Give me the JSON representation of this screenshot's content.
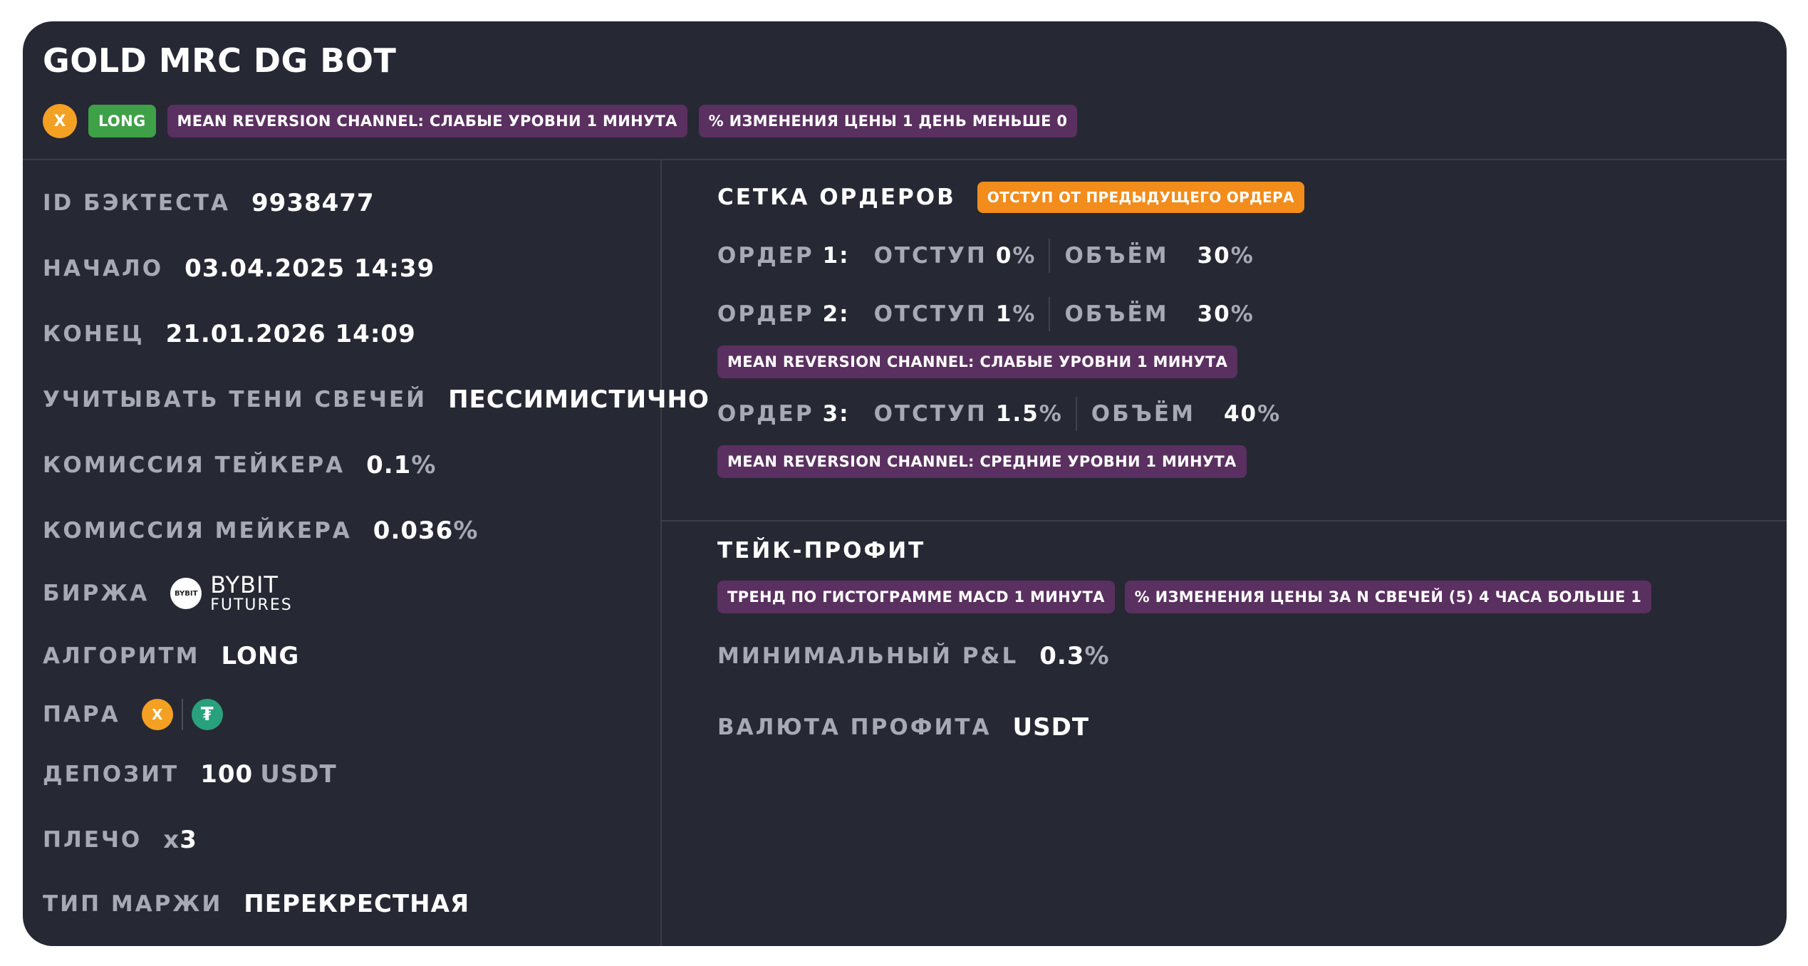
{
  "header": {
    "title": "GOLD MRC DG BOT",
    "coin_symbol": "X",
    "tags": {
      "direction": "LONG",
      "condition1": "MEAN REVERSION CHANNEL: СЛАБЫЕ УРОВНИ 1 МИНУТА",
      "condition2": "% ИЗМЕНЕНИЯ ЦЕНЫ 1 ДЕНЬ МЕНЬШЕ 0"
    }
  },
  "details": {
    "backtest_id": {
      "label": "ID БЭКТЕСТА",
      "value": "9938477"
    },
    "start": {
      "label": "НАЧАЛО",
      "value": "03.04.2025 14:39"
    },
    "end": {
      "label": "КОНЕЦ",
      "value": "21.01.2026 14:09"
    },
    "shadows": {
      "label": "УЧИТЫВАТЬ ТЕНИ СВЕЧЕЙ",
      "value": "ПЕССИМИСТИЧНО"
    },
    "taker_fee": {
      "label": "КОМИССИЯ ТЕЙКЕРА",
      "value": "0.1",
      "unit": "%"
    },
    "maker_fee": {
      "label": "КОМИССИЯ МЕЙКЕРА",
      "value": "0.036",
      "unit": "%"
    },
    "exchange": {
      "label": "БИРЖА",
      "logo_text": "BYBIT",
      "name": "BYBIT",
      "sub": "FUTURES"
    },
    "algorithm": {
      "label": "АЛГОРИТМ",
      "value": "LONG"
    },
    "pair": {
      "label": "ПАРА",
      "base_symbol": "X",
      "quote_symbol": "₮"
    },
    "deposit": {
      "label": "ДЕПОЗИТ",
      "value": "100",
      "unit": "USDT"
    },
    "leverage": {
      "label": "ПЛЕЧО",
      "prefix": "x",
      "value": "3"
    },
    "margin": {
      "label": "ТИП МАРЖИ",
      "value": "ПЕРЕКРЕСТНАЯ"
    }
  },
  "orders": {
    "title": "СЕТКА ОРДЕРОВ",
    "mode_badge": "ОТСТУП ОТ ПРЕДЫДУЩЕГО ОРДЕРА",
    "offset_label": "ОТСТУП",
    "volume_label": "ОБЪЁМ",
    "percent": "%",
    "items": [
      {
        "label": "ОРДЕР",
        "num": "1:",
        "offset": "0",
        "volume": "30"
      },
      {
        "label": "ОРДЕР",
        "num": "2:",
        "offset": "1",
        "volume": "30",
        "condition": "MEAN REVERSION CHANNEL: СЛАБЫЕ УРОВНИ 1 МИНУТА"
      },
      {
        "label": "ОРДЕР",
        "num": "3:",
        "offset": "1.5",
        "volume": "40",
        "condition": "MEAN REVERSION CHANNEL: СРЕДНИЕ УРОВНИ 1 МИНУТА"
      }
    ]
  },
  "take_profit": {
    "title": "ТЕЙК-ПРОФИТ",
    "conditions": [
      "ТРЕНД ПО ГИСТОГРАММЕ MACD 1 МИНУТА",
      "% ИЗМЕНЕНИЯ ЦЕНЫ ЗА N СВЕЧЕЙ (5) 4 ЧАСА БОЛЬШЕ 1"
    ],
    "min_pnl": {
      "label": "МИНИМАЛЬНЫЙ P&L",
      "value": "0.3",
      "unit": "%"
    },
    "currency": {
      "label": "ВАЛЮТА ПРОФИТА",
      "value": "USDT"
    }
  },
  "colors": {
    "card_bg": "#262834",
    "label": "#a7a9b4",
    "long_tag": "#3fa147",
    "condition_tag": "#5a3060",
    "mode_badge": "#f28c1b",
    "coin": "#f3a023",
    "tether": "#28a17c"
  },
  "icons": {
    "coin": "gold-coin-icon",
    "quote": "tether-icon",
    "exchange": "bybit-logo-icon"
  }
}
